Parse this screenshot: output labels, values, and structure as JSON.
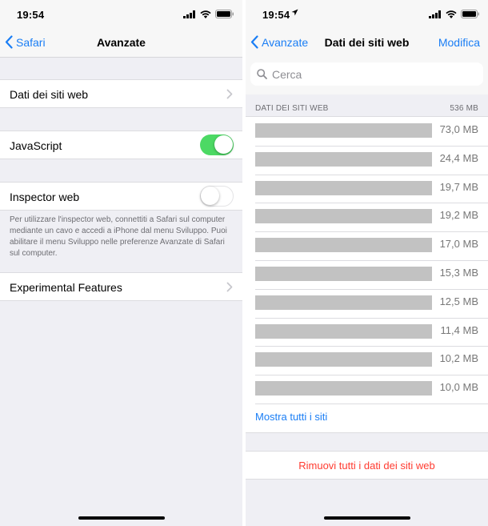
{
  "left": {
    "status": {
      "time": "19:54"
    },
    "nav": {
      "back_label": "Safari",
      "title": "Avanzate"
    },
    "cells": {
      "website_data": "Dati dei siti web",
      "javascript": "JavaScript",
      "javascript_on": true,
      "web_inspector": "Inspector web",
      "web_inspector_on": false,
      "footnote": "Per utilizzare l'inspector web, connettiti a Safari sul computer mediante un cavo e accedi a iPhone dal menu Sviluppo. Puoi abilitare il menu Sviluppo nelle preferenze Avanzate di Safari sul computer.",
      "experimental": "Experimental Features"
    }
  },
  "right": {
    "status": {
      "time": "19:54"
    },
    "nav": {
      "back_label": "Avanzate",
      "title": "Dati dei siti web",
      "action": "Modifica"
    },
    "search": {
      "placeholder": "Cerca"
    },
    "section": {
      "title": "DATI DEI SITI WEB",
      "total": "536 MB"
    },
    "sites": [
      {
        "size": "73,0 MB"
      },
      {
        "size": "24,4 MB"
      },
      {
        "size": "19,7 MB"
      },
      {
        "size": "19,2 MB"
      },
      {
        "size": "17,0 MB"
      },
      {
        "size": "15,3 MB"
      },
      {
        "size": "12,5 MB"
      },
      {
        "size": "11,4 MB"
      },
      {
        "size": "10,2 MB"
      },
      {
        "size": "10,0 MB"
      }
    ],
    "show_all": "Mostra tutti i siti",
    "remove_all": "Rimuovi tutti i dati dei siti web"
  },
  "colors": {
    "accent": "#1a7ef5",
    "toggle_on": "#4cd964",
    "destructive": "#ff3b30"
  }
}
